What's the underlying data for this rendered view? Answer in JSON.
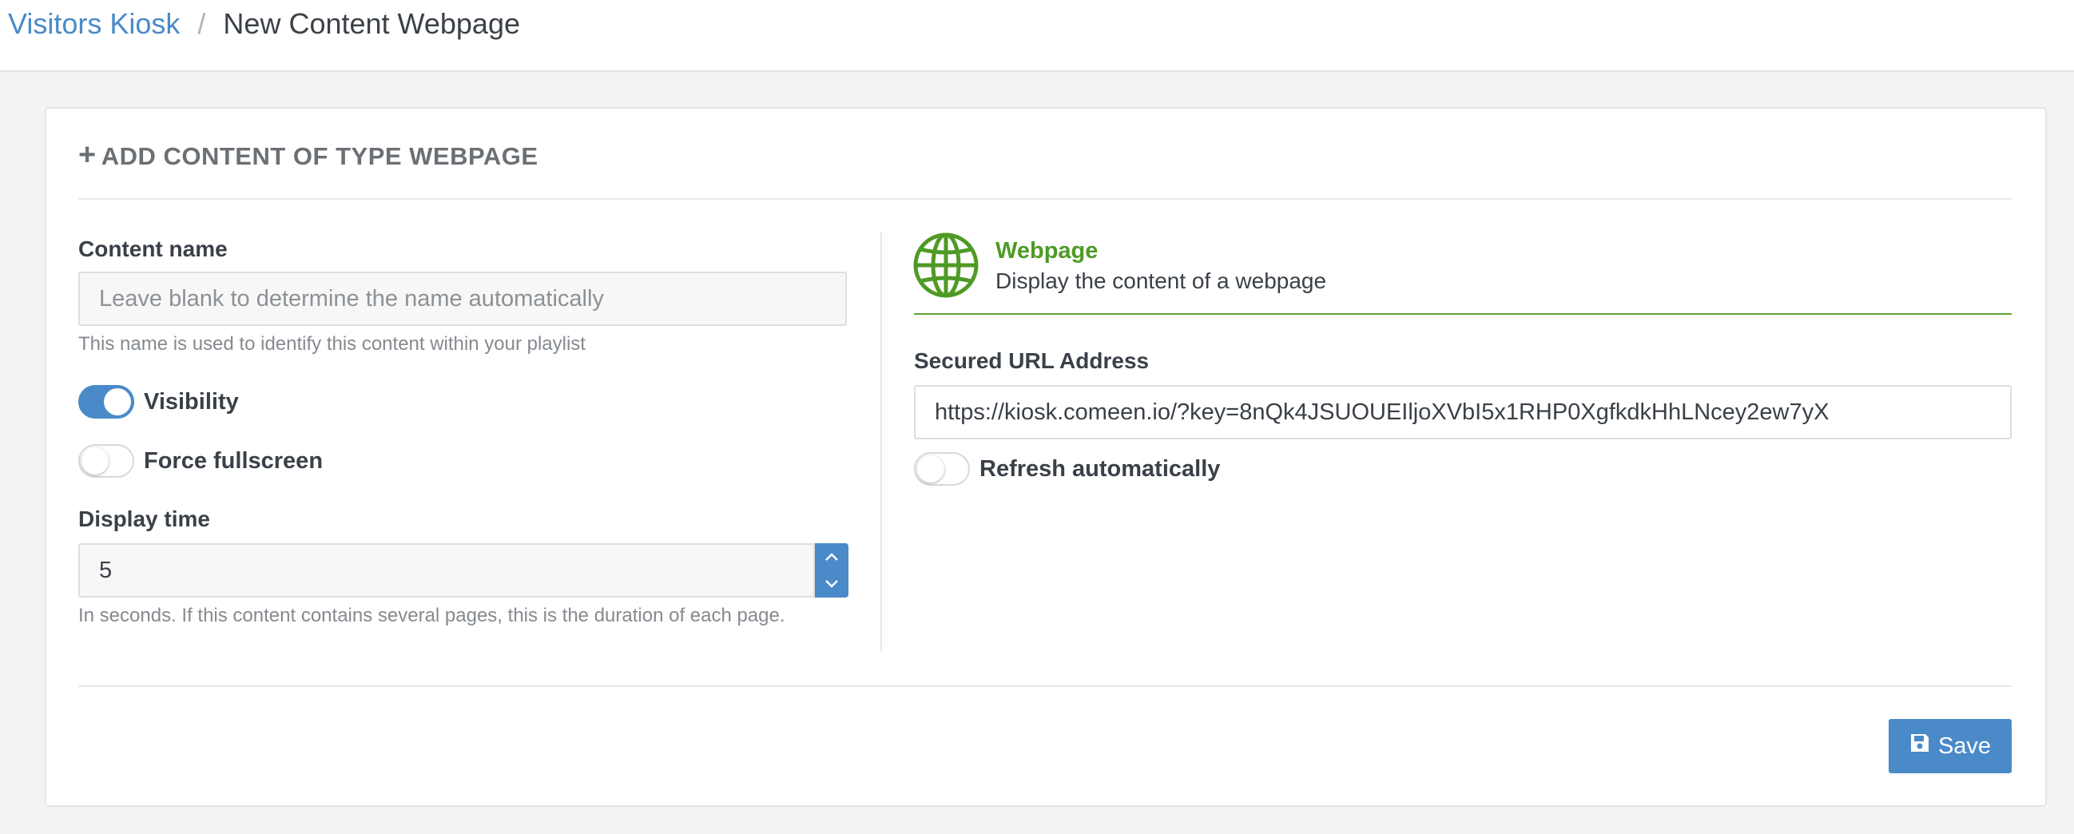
{
  "breadcrumb": {
    "parent": "Visitors Kiosk",
    "separator": "/",
    "current": "New Content Webpage"
  },
  "card": {
    "title": "ADD CONTENT OF TYPE WEBPAGE",
    "title_icon": "plus-icon"
  },
  "content_name": {
    "label": "Content name",
    "value": "",
    "placeholder": "Leave blank to determine the name automatically",
    "help": "This name is used to identify this content within your playlist"
  },
  "visibility": {
    "label": "Visibility",
    "checked": true
  },
  "force_fullscreen": {
    "label": "Force fullscreen",
    "checked": false
  },
  "display_time": {
    "label": "Display time",
    "value": "5",
    "help": "In seconds. If this content contains several pages, this is the duration of each page."
  },
  "content_type": {
    "icon": "globe-icon",
    "title": "Webpage",
    "description": "Display the content of a webpage",
    "accent_color": "#4f9a25"
  },
  "url": {
    "label": "Secured URL Address",
    "value": "https://kiosk.comeen.io/?key=8nQk4JSUOUEIljoXVbI5x1RHP0XgfkdkHhLNcey2ew7yX"
  },
  "refresh": {
    "label": "Refresh automatically",
    "checked": false
  },
  "save": {
    "label": "Save",
    "icon": "save-icon"
  },
  "colors": {
    "primary": "#4a8ac8",
    "success": "#4f9a25",
    "background": "#f3f3f3"
  }
}
